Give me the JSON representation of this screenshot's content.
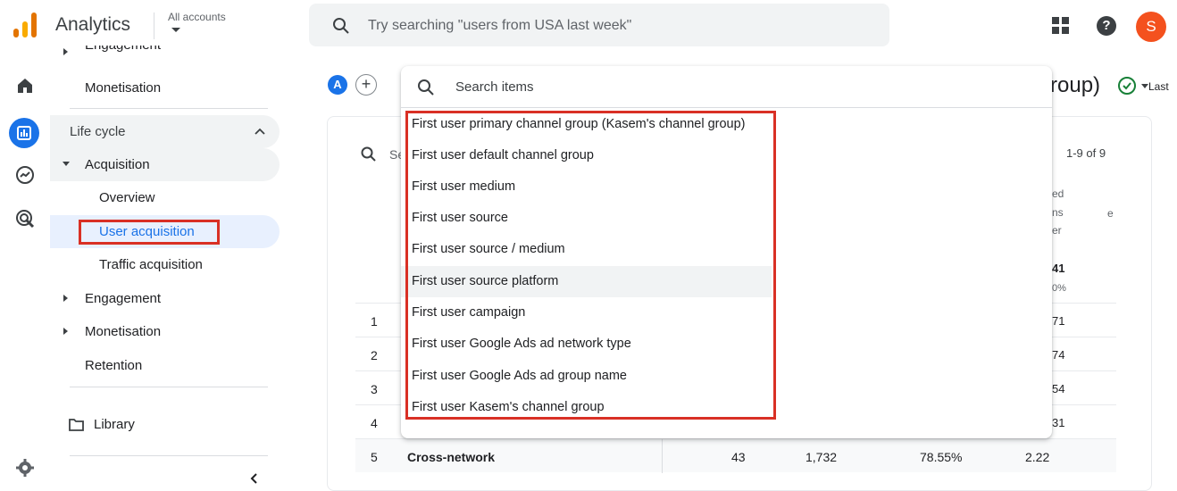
{
  "app": {
    "title": "Analytics",
    "accounts_label": "All accounts",
    "avatar_initial": "S"
  },
  "search": {
    "placeholder": "Try searching \"users from USA last week\""
  },
  "sidebar": {
    "engagement_top": "Engagement",
    "monetisation_top": "Monetisation",
    "section": "Life cycle",
    "acquisition": "Acquisition",
    "overview": "Overview",
    "user_acquisition": "User acquisition",
    "traffic_acquisition": "Traffic acquisition",
    "engagement": "Engagement",
    "monetisation": "Monetisation",
    "retention": "Retention",
    "library": "Library"
  },
  "main": {
    "chip_a": "A",
    "chip_plus": "+",
    "title_fragment": "roup)",
    "last_fragment": "Last",
    "table_search_fragment": "Se",
    "pager": "1-9 of 9",
    "col_frag_1": "ed",
    "col_frag_2": "ns",
    "col_frag_3": "er",
    "col_frag_4": "e",
    "total_frag": "41",
    "total_pct_frag": "0%",
    "rows": [
      {
        "num": "1",
        "frag": "71"
      },
      {
        "num": "2",
        "frag": "74"
      },
      {
        "num": "3",
        "frag": "54"
      },
      {
        "num": "4",
        "frag": "31"
      },
      {
        "num": "5",
        "name": "Cross-network",
        "c1": "43",
        "c2": "1,732",
        "c3": "78.55%",
        "c4": "2.22"
      }
    ]
  },
  "dropdown": {
    "placeholder": "Search items",
    "items": [
      "First user primary channel group (Kasem's channel group)",
      "First user default channel group",
      "First user medium",
      "First user source",
      "First user source / medium",
      "First user source platform",
      "First user campaign",
      "First user Google Ads ad network type",
      "First user Google Ads ad group name",
      "First user Kasem's channel group"
    ]
  },
  "colors": {
    "accent": "#1a73e8",
    "highlight": "#d93025",
    "avatar": "#f4511e"
  }
}
